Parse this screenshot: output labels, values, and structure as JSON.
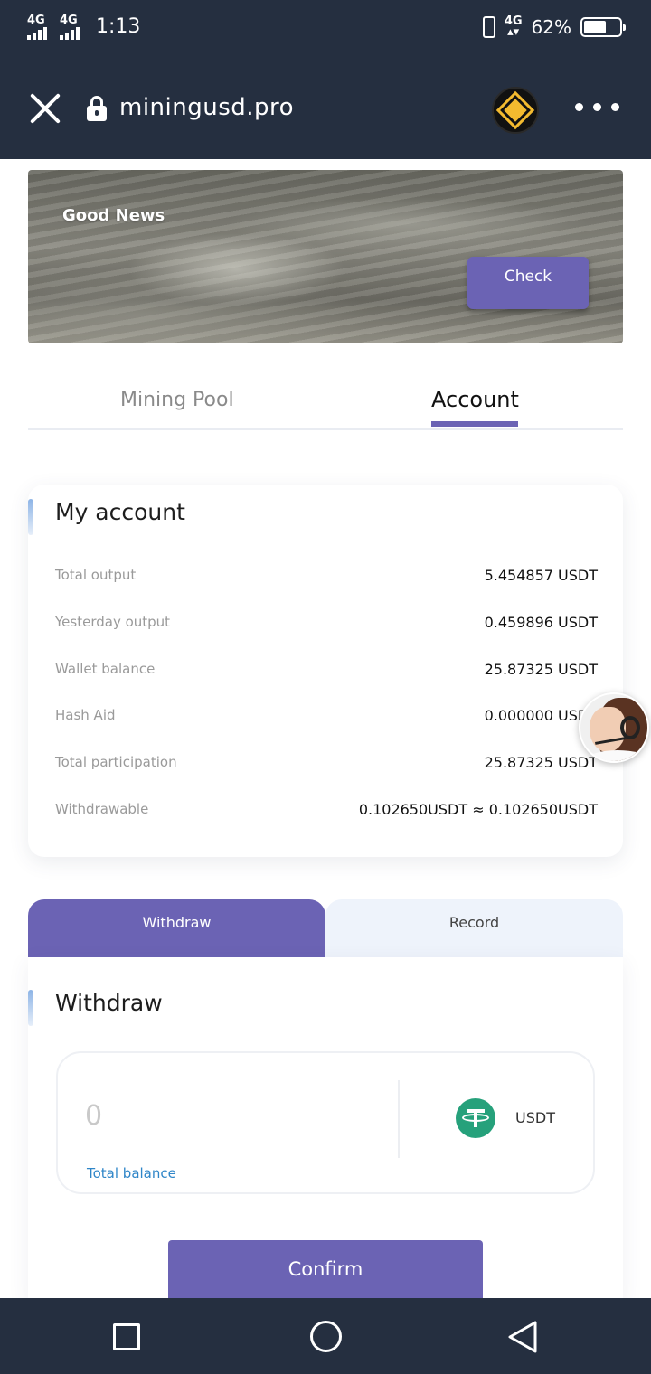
{
  "status_bar": {
    "network_1": "4G",
    "network_2": "4G",
    "time": "1:13",
    "network_right": "4G",
    "battery": "62%",
    "battery_level": 0.62
  },
  "browser": {
    "url": "miningusd.pro",
    "close_icon": "close-icon",
    "lock_icon": "lock-icon",
    "extension_icon": "bnb-logo-icon",
    "menu_icon": "more-dots-icon"
  },
  "banner": {
    "title": "Good News",
    "button": "Check"
  },
  "tabs": {
    "pool": "Mining Pool",
    "account": "Account",
    "active": "Account"
  },
  "account": {
    "title": "My account",
    "rows": [
      {
        "label": "Total output",
        "value": "5.454857 USDT"
      },
      {
        "label": "Yesterday output",
        "value": "0.459896 USDT"
      },
      {
        "label": "Wallet balance",
        "value": "25.87325 USDT"
      },
      {
        "label": "Hash Aid",
        "value": "0.000000 USDT"
      },
      {
        "label": "Total participation",
        "value": "25.87325 USDT"
      },
      {
        "label": "Withdrawable",
        "value": "0.102650USDT ≈ 0.102650USDT"
      }
    ]
  },
  "withdraw_tabs": {
    "withdraw": "Withdraw",
    "record": "Record",
    "active": "Withdraw"
  },
  "withdraw": {
    "title": "Withdraw",
    "amount_placeholder": "0",
    "total_balance_link": "Total balance",
    "currency": "USDT",
    "currency_icon": "tether-usdt-icon",
    "confirm": "Confirm"
  },
  "colors": {
    "header_bg": "#252f40",
    "accent": "#6b63b4",
    "link": "#2f86c8",
    "usdt_green": "#26a17b"
  }
}
